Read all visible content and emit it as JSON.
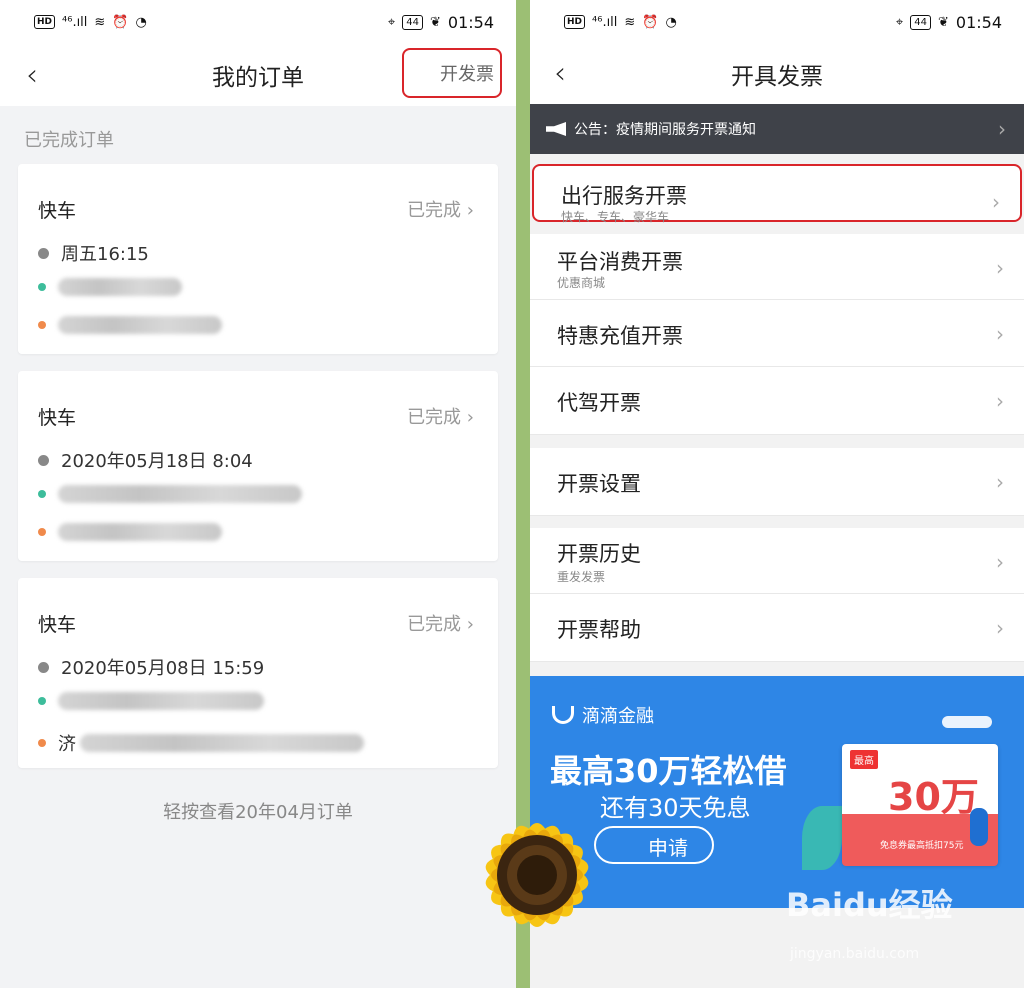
{
  "statusbar": {
    "hd": "HD",
    "net": "⁴⁶.ıll",
    "battery": "44",
    "time": "01:54"
  },
  "left": {
    "nav_title": "我的订单",
    "nav_action": "开发票",
    "section": "已完成订单",
    "orders": [
      {
        "type": "快车",
        "status": "已完成",
        "time": "周五16:15",
        "start_prefix": "",
        "end_prefix": ""
      },
      {
        "type": "快车",
        "status": "已完成",
        "time": "2020年05月18日 8:04",
        "start_prefix": "",
        "end_prefix": ""
      },
      {
        "type": "快车",
        "status": "已完成",
        "time": "2020年05月08日 15:59",
        "start_prefix": "",
        "end_prefix": "济"
      }
    ],
    "load_more": "轻按查看20年04月订单"
  },
  "right": {
    "nav_title": "开具发票",
    "notice": "公告：疫情期间服务开票通知",
    "items": [
      {
        "label": "出行服务开票",
        "sub": "快车、专车、豪华车"
      },
      {
        "label": "平台消费开票",
        "sub": "优惠商城"
      },
      {
        "label": "特惠充值开票",
        "sub": ""
      },
      {
        "label": "代驾开票",
        "sub": ""
      },
      {
        "label": "开票设置",
        "sub": ""
      },
      {
        "label": "开票历史",
        "sub": "重发发票"
      },
      {
        "label": "开票帮助",
        "sub": ""
      }
    ],
    "banner": {
      "brand": "滴滴金融",
      "title": "最高30万轻松借",
      "subtitle": "还有30天免息",
      "button": "申请",
      "card_tag": "最高",
      "card_amount": "30万",
      "card_note": "免息券最高抵扣75元"
    }
  },
  "watermark": {
    "main": "Baidu经验",
    "sub": "jingyan.baidu.com"
  },
  "colors": {
    "highlight": "#d9252a",
    "start_dot": "#3dbd9b",
    "end_dot": "#f08a4b",
    "banner": "#2e86e6",
    "divider": "#9cbf74"
  }
}
